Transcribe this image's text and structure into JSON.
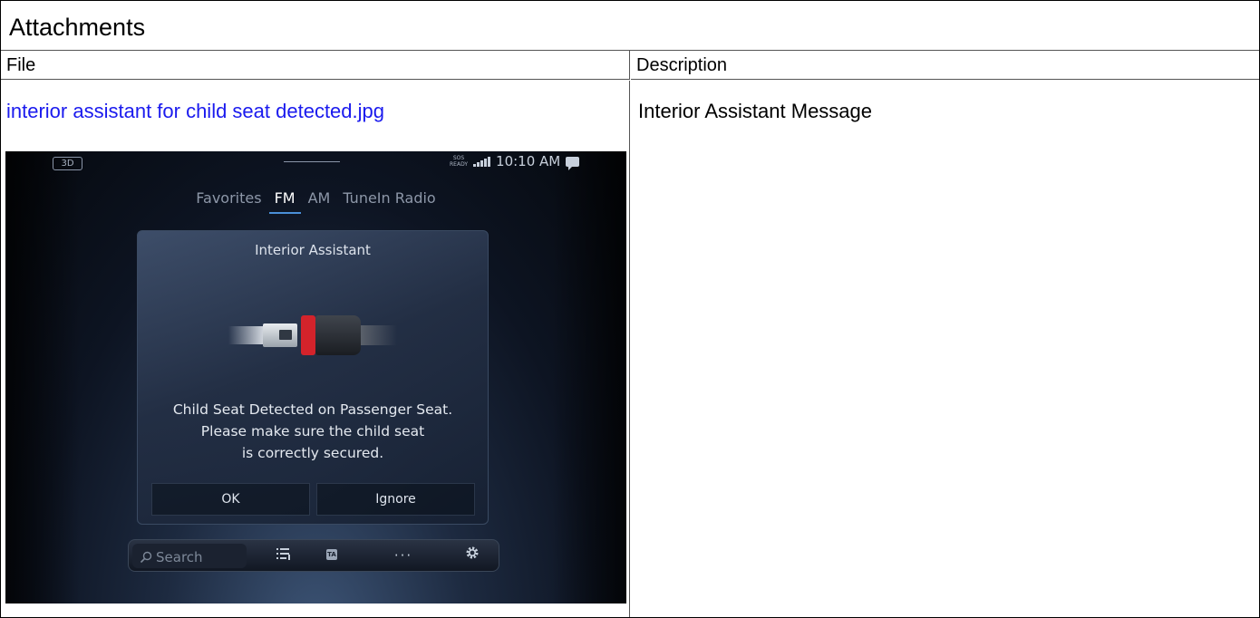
{
  "section": {
    "title": "Attachments"
  },
  "table": {
    "headers": {
      "file": "File",
      "description": "Description"
    },
    "rows": [
      {
        "file_link": "interior assistant for child seat detected.jpg",
        "description": "Interior Assistant Message"
      }
    ]
  },
  "screenshot": {
    "top_left_button": "3D",
    "status": {
      "sos_line1": "SOS",
      "sos_line2": "READY",
      "time": "10:10 AM"
    },
    "tabs": [
      "Favorites",
      "FM",
      "AM",
      "TuneIn Radio"
    ],
    "active_tab": "FM",
    "dialog": {
      "title": "Interior Assistant",
      "message_line1": "Child Seat Detected on Passenger Seat.",
      "message_line2": "Please make sure the child seat",
      "message_line3": "is correctly secured.",
      "ok_label": "OK",
      "ignore_label": "Ignore"
    },
    "dock": {
      "search_placeholder": "Search",
      "ta_label": "TA",
      "icons": [
        "search-icon",
        "list-icon",
        "ta-icon",
        "more-icon",
        "gear-icon"
      ]
    }
  },
  "colors": {
    "link": "#1a1aee",
    "belt_release": "#d3232b",
    "tab_underline": "#4a8fd8"
  }
}
